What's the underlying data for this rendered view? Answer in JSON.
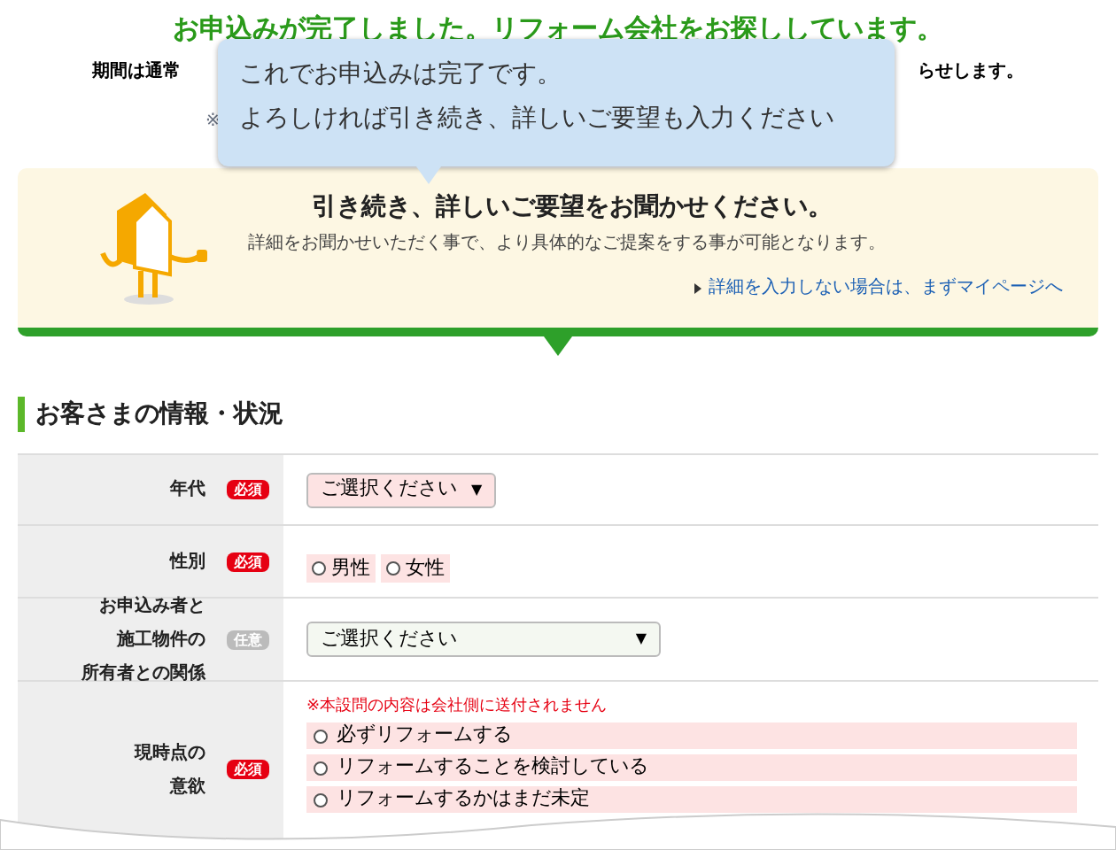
{
  "header": {
    "title": "お申込みが完了しました。リフォーム会社をお探ししています。",
    "note_left": "期間は通常",
    "note_right": "らせします。",
    "note_mark": "※"
  },
  "tooltip": {
    "lines": [
      "これでお申込みは完了です。",
      "よろしければ引き続き、詳しいご要望も入力ください"
    ]
  },
  "banner": {
    "title": "引き続き、詳しいご要望をお聞かせください。",
    "text": "詳細をお聞かせいただく事で、より具体的なご提案をする事が可能となります。",
    "link": "詳細を入力しない場合は、まずマイページへ"
  },
  "section": {
    "title": "お客さまの情報・状況"
  },
  "rows": [
    {
      "label": [
        "年代"
      ],
      "badge": {
        "text": "必須",
        "kind": "required"
      },
      "kind": "select",
      "select": {
        "value": "ご選択ください",
        "arrow": "▼",
        "required": true
      }
    },
    {
      "label": [
        "性別"
      ],
      "badge": {
        "text": "必須",
        "kind": "required"
      },
      "kind": "radio",
      "options": [
        {
          "label": "男性",
          "checked": false
        },
        {
          "label": "女性",
          "checked": false
        }
      ]
    },
    {
      "label": [
        "お申込み者と",
        "施工物件の",
        "所有者との関係"
      ],
      "badge": {
        "text": "任意",
        "kind": "optional"
      },
      "kind": "select",
      "select": {
        "value": "ご選択ください",
        "arrow": "▼",
        "required": false
      }
    },
    {
      "label": [
        "現時点の",
        "意欲"
      ],
      "badge": {
        "text": "必須",
        "kind": "required"
      },
      "kind": "radio-list",
      "notice": "※本設問の内容は会社側に送付されません",
      "options": [
        {
          "label": "必ずリフォームする",
          "checked": false
        },
        {
          "label": "リフォームすることを検討している",
          "checked": false
        },
        {
          "label": "リフォームするかはまだ未定",
          "checked": false
        }
      ]
    }
  ]
}
